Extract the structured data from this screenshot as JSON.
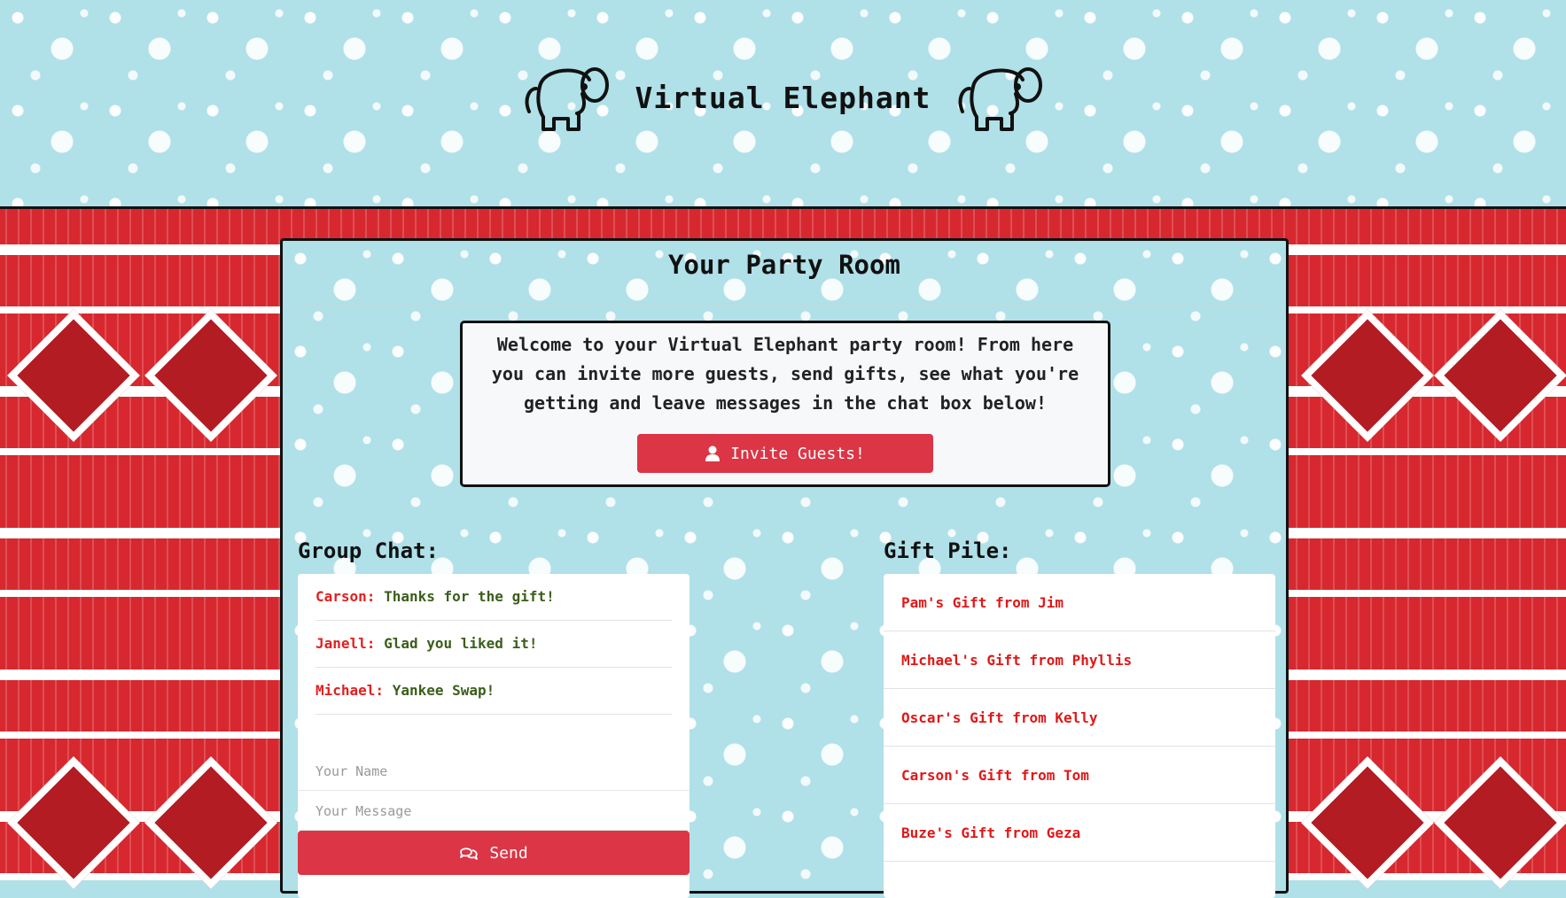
{
  "brand": {
    "title": "Virtual Elephant",
    "left_logo": "elephant-icon",
    "right_logo": "elephant-icon"
  },
  "room": {
    "title": "Your Party Room",
    "welcome_text": "Welcome to your Virtual Elephant party room! From here you can invite more guests, send gifts, see what you're getting and leave messages in the chat box below!",
    "invite_button": "Invite Guests!",
    "invite_icon": "user-icon"
  },
  "chat": {
    "label": "Group Chat:",
    "messages": [
      {
        "name": "Carson:",
        "text": "Thanks for the gift!"
      },
      {
        "name": "Janell:",
        "text": "Glad you liked it!"
      },
      {
        "name": "Michael:",
        "text": "Yankee Swap!"
      }
    ],
    "name_placeholder": "Your Name",
    "message_placeholder": "Your Message",
    "send_label": "Send",
    "send_icon": "chat-bubbles-icon"
  },
  "gifts": {
    "label": "Gift Pile:",
    "items": [
      "Pam's Gift from Jim",
      "Michael's Gift from Phyllis",
      "Oscar's Gift from Kelly",
      "Carson's Gift from Tom",
      "Buze's Gift from Geza"
    ]
  },
  "colors": {
    "sky": "#b0e0e8",
    "sweater_red": "#d7282f",
    "button_red": "#dc3545",
    "name_red": "#e02020",
    "message_green": "#3b5e1a"
  }
}
